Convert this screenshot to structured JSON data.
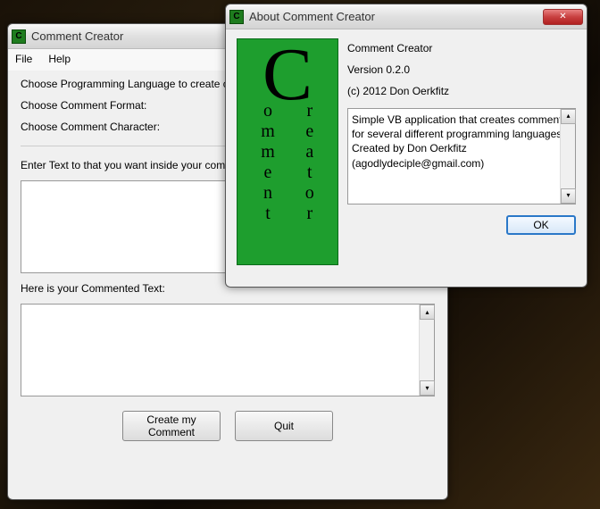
{
  "mainWindow": {
    "title": "Comment Creator",
    "menu": {
      "file": "File",
      "help": "Help"
    },
    "labels": {
      "chooseLang": "Choose Programming Language to create co",
      "chooseFormat": "Choose Comment Format:",
      "chooseChar": "Choose Comment Character:",
      "enterText": "Enter Text to that you want inside your comm",
      "resultLabel": "Here is your Commented Text:"
    },
    "buttons": {
      "create": "Create my Comment",
      "quit": "Quit"
    }
  },
  "aboutWindow": {
    "title": "About Comment Creator",
    "info": {
      "name": "Comment Creator",
      "version": "Version 0.2.0",
      "copyright": "(c) 2012 Don Oerkfitz"
    },
    "description": "Simple VB application that creates comments for several different programming languages.\nCreated by Don Oerkfitz (agodlydeciple@gmail.com)",
    "okLabel": "OK",
    "logo": {
      "bigLetter": "C",
      "leftCol": [
        "o",
        "m",
        "m",
        "e",
        "n",
        "t"
      ],
      "rightCol": [
        "r",
        "e",
        "a",
        "t",
        "o",
        "r"
      ]
    }
  }
}
